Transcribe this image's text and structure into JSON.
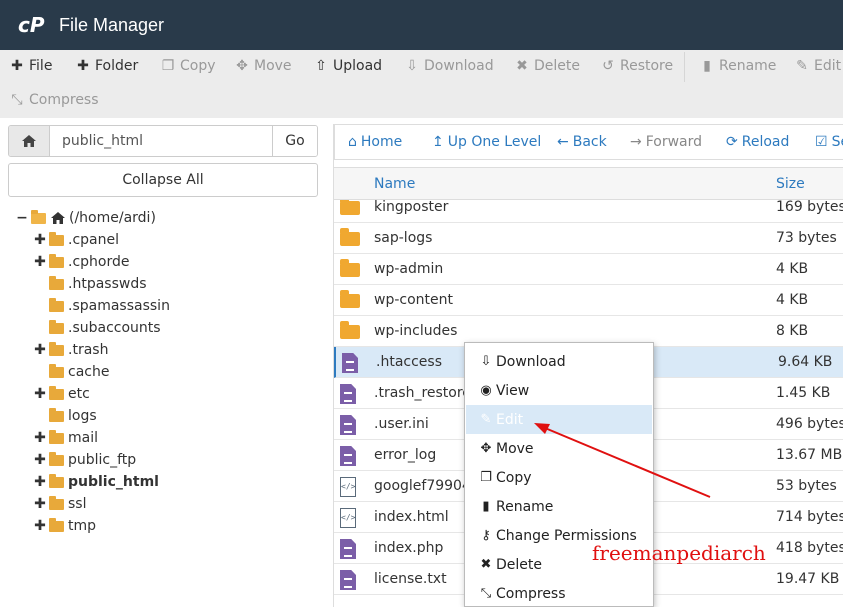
{
  "header": {
    "title": "File Manager"
  },
  "toolbar": {
    "items": [
      {
        "label": "File",
        "icon": "plus-icon",
        "glyph": "✚",
        "enabled": true
      },
      {
        "label": "Folder",
        "icon": "plus-icon",
        "glyph": "✚",
        "enabled": true
      },
      {
        "label": "Copy",
        "icon": "copy-icon",
        "glyph": "❐",
        "enabled": false
      },
      {
        "label": "Move",
        "icon": "move-icon",
        "glyph": "✥",
        "enabled": false
      },
      {
        "label": "Upload",
        "icon": "upload-icon",
        "glyph": "⭱",
        "enabled": true
      },
      {
        "label": "Download",
        "icon": "download-icon",
        "glyph": "⭳",
        "enabled": false
      },
      {
        "label": "Delete",
        "icon": "times-icon",
        "glyph": "✖",
        "enabled": false
      },
      {
        "label": "Restore",
        "icon": "undo-icon",
        "glyph": "↺",
        "enabled": false
      },
      {
        "label": "Rename",
        "icon": "file-icon",
        "glyph": "▮",
        "enabled": false
      },
      {
        "label": "Edit",
        "icon": "pencil-icon",
        "glyph": "✎",
        "enabled": false
      },
      {
        "label": "Compress",
        "icon": "compress-icon",
        "glyph": "⤡",
        "enabled": false
      }
    ]
  },
  "address": {
    "value": "public_html",
    "go_label": "Go",
    "collapse_label": "Collapse All"
  },
  "tree": {
    "root_label": "(/home/ardi)",
    "items": [
      {
        "label": ".cpanel",
        "expandable": true,
        "bold": false
      },
      {
        "label": ".cphorde",
        "expandable": true,
        "bold": false
      },
      {
        "label": ".htpasswds",
        "expandable": false,
        "bold": false
      },
      {
        "label": ".spamassassin",
        "expandable": false,
        "bold": false
      },
      {
        "label": ".subaccounts",
        "expandable": false,
        "bold": false
      },
      {
        "label": ".trash",
        "expandable": true,
        "bold": false
      },
      {
        "label": "cache",
        "expandable": false,
        "bold": false
      },
      {
        "label": "etc",
        "expandable": true,
        "bold": false
      },
      {
        "label": "logs",
        "expandable": false,
        "bold": false
      },
      {
        "label": "mail",
        "expandable": true,
        "bold": false
      },
      {
        "label": "public_ftp",
        "expandable": true,
        "bold": false
      },
      {
        "label": "public_html",
        "expandable": true,
        "bold": true
      },
      {
        "label": "ssl",
        "expandable": true,
        "bold": false
      },
      {
        "label": "tmp",
        "expandable": true,
        "bold": false
      }
    ]
  },
  "nav": {
    "items": [
      {
        "label": "Home",
        "icon": "home-icon",
        "glyph": "⌂",
        "enabled": true
      },
      {
        "label": "Up One Level",
        "icon": "level-up-icon",
        "glyph": "↥",
        "enabled": true
      },
      {
        "label": "Back",
        "icon": "arrow-left-icon",
        "glyph": "←",
        "enabled": true
      },
      {
        "label": "Forward",
        "icon": "arrow-right-icon",
        "glyph": "→",
        "enabled": false
      },
      {
        "label": "Reload",
        "icon": "reload-icon",
        "glyph": "⟳",
        "enabled": true
      },
      {
        "label": "Se",
        "icon": "select-all-icon",
        "glyph": "☑",
        "enabled": true
      }
    ]
  },
  "list": {
    "col_name": "Name",
    "col_size": "Size",
    "rows": [
      {
        "name": "kingposter",
        "size": "169 bytes",
        "type": "folder"
      },
      {
        "name": "sap-logs",
        "size": "73 bytes",
        "type": "folder"
      },
      {
        "name": "wp-admin",
        "size": "4 KB",
        "type": "folder"
      },
      {
        "name": "wp-content",
        "size": "4 KB",
        "type": "folder"
      },
      {
        "name": "wp-includes",
        "size": "8 KB",
        "type": "folder"
      },
      {
        "name": ".htaccess",
        "size": "9.64 KB",
        "type": "text",
        "selected": true
      },
      {
        "name": ".trash_restore",
        "size": "1.45 KB",
        "type": "text"
      },
      {
        "name": ".user.ini",
        "size": "496 bytes",
        "type": "text"
      },
      {
        "name": "error_log",
        "size": "13.67 MB",
        "type": "text"
      },
      {
        "name": "googlef799041",
        "size": "53 bytes",
        "type": "code"
      },
      {
        "name": "index.html",
        "size": "714 bytes",
        "type": "code"
      },
      {
        "name": "index.php",
        "size": "418 bytes",
        "type": "text"
      },
      {
        "name": "license.txt",
        "size": "19.47 KB",
        "type": "text"
      }
    ]
  },
  "context_menu": {
    "items": [
      {
        "label": "Download",
        "icon": "download-icon",
        "glyph": "⭳"
      },
      {
        "label": "View",
        "icon": "eye-icon",
        "glyph": "👁"
      },
      {
        "label": "Edit",
        "icon": "pencil-icon",
        "glyph": "✎",
        "active": true
      },
      {
        "label": "Move",
        "icon": "move-icon",
        "glyph": "✥"
      },
      {
        "label": "Copy",
        "icon": "copy-icon",
        "glyph": "❐"
      },
      {
        "label": "Rename",
        "icon": "file-icon",
        "glyph": "▮"
      },
      {
        "label": "Change Permissions",
        "icon": "key-icon",
        "glyph": "⚷"
      },
      {
        "label": "Delete",
        "icon": "times-icon",
        "glyph": "✖"
      },
      {
        "label": "Compress",
        "icon": "compress-icon",
        "glyph": "⤡"
      }
    ]
  },
  "watermark": "freemanpediarch",
  "colors": {
    "header_bg": "#293a4a",
    "link": "#2d7abf",
    "folder": "#f0a830",
    "file": "#7b5ea8",
    "annotation": "#e01010"
  }
}
